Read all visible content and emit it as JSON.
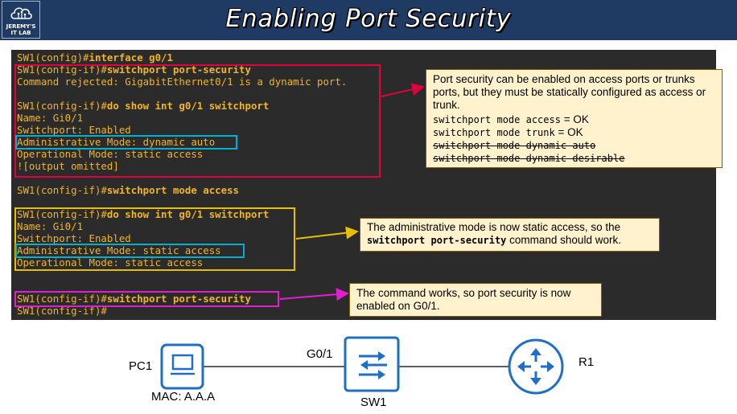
{
  "header": {
    "title": "Enabling Port Security",
    "logo_line1": "JEREMY'S",
    "logo_line2": "IT LAB",
    "bg_color": "#1f3a63"
  },
  "terminal": {
    "bg_color": "#2b2b2b",
    "text_color": "#f0b429",
    "lines": {
      "l1_prompt": "SW1(config)#",
      "l1_cmd": "interface g0/1",
      "l2_prompt": "SW1(config-if)#",
      "l2_cmd": "switchport port-security",
      "l3": "Command rejected: GigabitEthernet0/1 is a dynamic port.",
      "l4_prompt": "SW1(config-if)#",
      "l4_cmd": "do show int g0/1 switchport",
      "l5": "Name: Gi0/1",
      "l6": "Switchport: Enabled",
      "l7": "Administrative Mode: dynamic auto",
      "l8": "Operational Mode: static access",
      "l9": "![output omitted]",
      "l10_prompt": "SW1(config-if)#",
      "l10_cmd": "switchport mode access",
      "l11_prompt": "SW1(config-if)#",
      "l11_cmd": "do show int g0/1 switchport",
      "l12": "Name: Gi0/1",
      "l13": "Switchport: Enabled",
      "l14": "Administrative Mode: static access",
      "l15": "Operational Mode: static access",
      "l16_prompt": "SW1(config-if)#",
      "l16_cmd": "switchport port-security",
      "l17": "SW1(config-if)#"
    }
  },
  "notes": {
    "note1_text": "Port security can be enabled on access ports or trunks ports, but they must be statically configured as access or trunk.",
    "note1_m1": "switchport mode access",
    "note1_m1_result": " = OK",
    "note1_m2": "switchport mode trunk",
    "note1_m2_result": " = OK",
    "note1_m3": "switchport mode dynamic auto",
    "note1_m4": "switchport mode dynamic desirable",
    "note2_part1": "The administrative mode is now static access, so the ",
    "note2_cmd": "switchport port-security",
    "note2_part2": " command should work.",
    "note3_text": "The command works, so port security is now enabled on G0/1."
  },
  "diagram": {
    "pc_label": "PC1",
    "mac_label": "MAC: A.A.A",
    "port_label": "G0/1",
    "switch_label": "SW1",
    "router_label": "R1",
    "device_color": "#1f6fc5"
  },
  "colors": {
    "red_box": "#e0003c",
    "cyan_box": "#00b0d0",
    "yellow_box": "#e8c000",
    "magenta_box": "#e020d0"
  }
}
